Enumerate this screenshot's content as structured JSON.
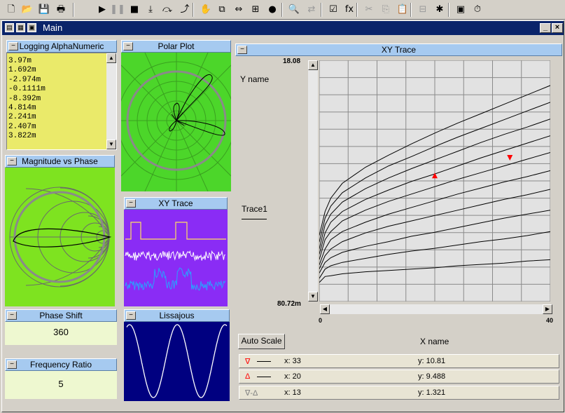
{
  "toolbar": {
    "buttons": [
      {
        "icon": "new-file-icon",
        "glyph": "🗋"
      },
      {
        "icon": "open-folder-icon",
        "glyph": "📂"
      },
      {
        "icon": "save-icon",
        "glyph": "💾"
      },
      {
        "icon": "print-icon",
        "glyph": "🖶"
      },
      {
        "icon": "run-icon",
        "glyph": "▶"
      },
      {
        "icon": "pause-icon",
        "glyph": "❚❚",
        "dim": true
      },
      {
        "icon": "stop-icon",
        "glyph": "■"
      },
      {
        "icon": "step-into-icon",
        "glyph": "⤓"
      },
      {
        "icon": "step-over-icon",
        "glyph": "⤼"
      },
      {
        "icon": "step-out-icon",
        "glyph": "⤴"
      },
      {
        "icon": "hand-icon",
        "glyph": "✋",
        "dim": true
      },
      {
        "icon": "copy-block-icon",
        "glyph": "⧉"
      },
      {
        "icon": "connect-icon",
        "glyph": "⇔"
      },
      {
        "icon": "component-icon",
        "glyph": "⊞"
      },
      {
        "icon": "globe-icon",
        "glyph": "●"
      },
      {
        "icon": "find-icon",
        "glyph": "🔍"
      },
      {
        "icon": "replace-icon",
        "glyph": "⇄",
        "dim": true
      },
      {
        "icon": "properties-icon",
        "glyph": "☑"
      },
      {
        "icon": "function-icon",
        "glyph": "fx"
      },
      {
        "icon": "cut-icon",
        "glyph": "✂",
        "dim": true
      },
      {
        "icon": "copy-icon",
        "glyph": "⎘",
        "dim": true
      },
      {
        "icon": "paste-icon",
        "glyph": "📋",
        "dim": true
      },
      {
        "icon": "align-icon",
        "glyph": "⊟",
        "dim": true
      },
      {
        "icon": "debug-icon",
        "glyph": "✱"
      },
      {
        "icon": "panel-icon",
        "glyph": "▣"
      },
      {
        "icon": "timer-icon",
        "glyph": "⏱"
      }
    ]
  },
  "window": {
    "title": "Main"
  },
  "logging": {
    "title": "Logging AlphaNumeric",
    "lines": [
      "3.97m",
      "1.692m",
      "-2.974m",
      "-0.1111m",
      "-8.392m",
      "4.814m",
      "2.241m",
      "2.407m",
      "3.822m"
    ]
  },
  "polar": {
    "title": "Polar Plot"
  },
  "magnitude": {
    "title": "Magnitude vs Phase"
  },
  "xy_small": {
    "title": "XY Trace"
  },
  "phase_shift": {
    "title": "Phase Shift",
    "value": "360"
  },
  "lissajous": {
    "title": "Lissajous"
  },
  "frequency_ratio": {
    "title": "Frequency Ratio",
    "value": "5"
  },
  "xy_main": {
    "title": "XY Trace",
    "y_name": "Y name",
    "x_name": "X name",
    "trace_label": "Trace1",
    "y_top": "18.08",
    "y_bottom": "80.72m",
    "x_left": "0",
    "x_right": "40",
    "autoscale_label": "Auto Scale"
  },
  "chart_data": {
    "type": "line",
    "title": "XY Trace",
    "xlabel": "X name",
    "ylabel": "Y name",
    "xlim": [
      0,
      40
    ],
    "ylim": [
      0.08072,
      18.08
    ],
    "grid": true,
    "series": [
      {
        "name": "Trace1",
        "x": [
          0,
          1,
          2,
          4,
          8,
          12,
          16,
          20,
          24,
          28,
          32,
          36,
          40
        ],
        "values": [
          1.5,
          1.95,
          2.0,
          2.15,
          2.3,
          2.4,
          2.5,
          2.6,
          2.75,
          2.85,
          2.95,
          3.1,
          3.2
        ]
      },
      {
        "x": [
          0,
          1,
          2,
          4,
          8,
          12,
          16,
          20,
          24,
          28,
          32,
          36,
          40
        ],
        "values": [
          1.8,
          2.5,
          2.75,
          3.0,
          3.3,
          3.6,
          3.85,
          4.05,
          4.3,
          4.55,
          4.75,
          5.0,
          5.3
        ]
      },
      {
        "x": [
          0,
          1,
          2,
          4,
          8,
          12,
          16,
          20,
          24,
          28,
          32,
          36,
          40
        ],
        "values": [
          2.2,
          3.0,
          3.35,
          3.75,
          4.2,
          4.55,
          4.95,
          5.25,
          5.6,
          5.95,
          6.3,
          6.6,
          6.9
        ]
      },
      {
        "x": [
          0,
          1,
          2,
          4,
          8,
          12,
          16,
          20,
          24,
          28,
          32,
          36,
          40
        ],
        "values": [
          2.5,
          3.5,
          4.0,
          4.55,
          5.2,
          5.7,
          6.1,
          6.5,
          6.9,
          7.3,
          7.7,
          8.05,
          8.45
        ]
      },
      {
        "x": [
          0,
          1,
          2,
          4,
          8,
          12,
          16,
          20,
          24,
          28,
          32,
          36,
          40
        ],
        "values": [
          2.8,
          4.0,
          4.7,
          5.3,
          6.0,
          6.6,
          7.1,
          7.6,
          8.1,
          8.55,
          9.0,
          9.4,
          9.85
        ]
      },
      {
        "x": [
          0,
          1,
          2,
          4,
          8,
          12,
          16,
          20,
          24,
          28,
          32,
          36,
          40
        ],
        "values": [
          3.2,
          4.7,
          5.3,
          6.1,
          6.9,
          7.55,
          8.1,
          8.65,
          9.2,
          9.7,
          10.2,
          10.7,
          11.2
        ]
      },
      {
        "x": [
          0,
          1,
          2,
          4,
          8,
          12,
          16,
          20,
          24,
          28,
          32,
          36,
          40
        ],
        "values": [
          3.6,
          5.2,
          6.0,
          6.8,
          7.7,
          8.4,
          9.05,
          9.6,
          10.2,
          10.8,
          11.35,
          11.9,
          12.45
        ]
      },
      {
        "x": [
          0,
          1,
          2,
          4,
          8,
          12,
          16,
          20,
          24,
          28,
          32,
          36,
          40
        ],
        "values": [
          4.0,
          5.8,
          6.6,
          7.5,
          8.5,
          9.3,
          10.0,
          10.65,
          11.3,
          11.95,
          12.55,
          13.1,
          13.7
        ]
      },
      {
        "x": [
          0,
          1,
          2,
          4,
          8,
          12,
          16,
          20,
          24,
          28,
          32,
          36,
          40
        ],
        "values": [
          4.5,
          6.3,
          7.2,
          8.2,
          9.3,
          10.2,
          10.9,
          11.65,
          12.35,
          13.0,
          13.65,
          14.3,
          14.95
        ]
      },
      {
        "x": [
          0,
          1,
          2,
          4,
          8,
          12,
          16,
          20,
          24,
          28,
          32,
          36,
          40
        ],
        "values": [
          5.0,
          6.8,
          7.8,
          8.9,
          10.1,
          11.0,
          11.85,
          12.65,
          13.4,
          14.1,
          14.8,
          15.5,
          16.2
        ]
      }
    ],
    "cursors": [
      {
        "symbol": "∇",
        "x": 33,
        "y": 10.81,
        "color": "#ff0000"
      },
      {
        "symbol": "Δ",
        "x": 20,
        "y": 9.488,
        "color": "#ff0000"
      }
    ]
  },
  "cursor_rows": [
    {
      "symbol": "∇",
      "x_text": "x: 33",
      "y_text": "y: 10.81",
      "color": "#ff0000"
    },
    {
      "symbol": "Δ",
      "x_text": "x: 20",
      "y_text": "y: 9.488",
      "color": "#ff0000"
    },
    {
      "symbol": "∇-Δ",
      "x_text": "x: 13",
      "y_text": "y: 1.321",
      "color": "#808080"
    }
  ],
  "colors": {
    "panel_header": "#a6caf0",
    "logging_bg": "#eaea6a",
    "polar_bg": "#4cd62a",
    "smith_bg": "#7ee320",
    "xy_small_bg": "#8a2cf5",
    "lissajous_bg": "#000080",
    "plot_bg": "#e2e2e2",
    "cursor_marker": "#ff0000",
    "title_bar": "#0a246a"
  }
}
